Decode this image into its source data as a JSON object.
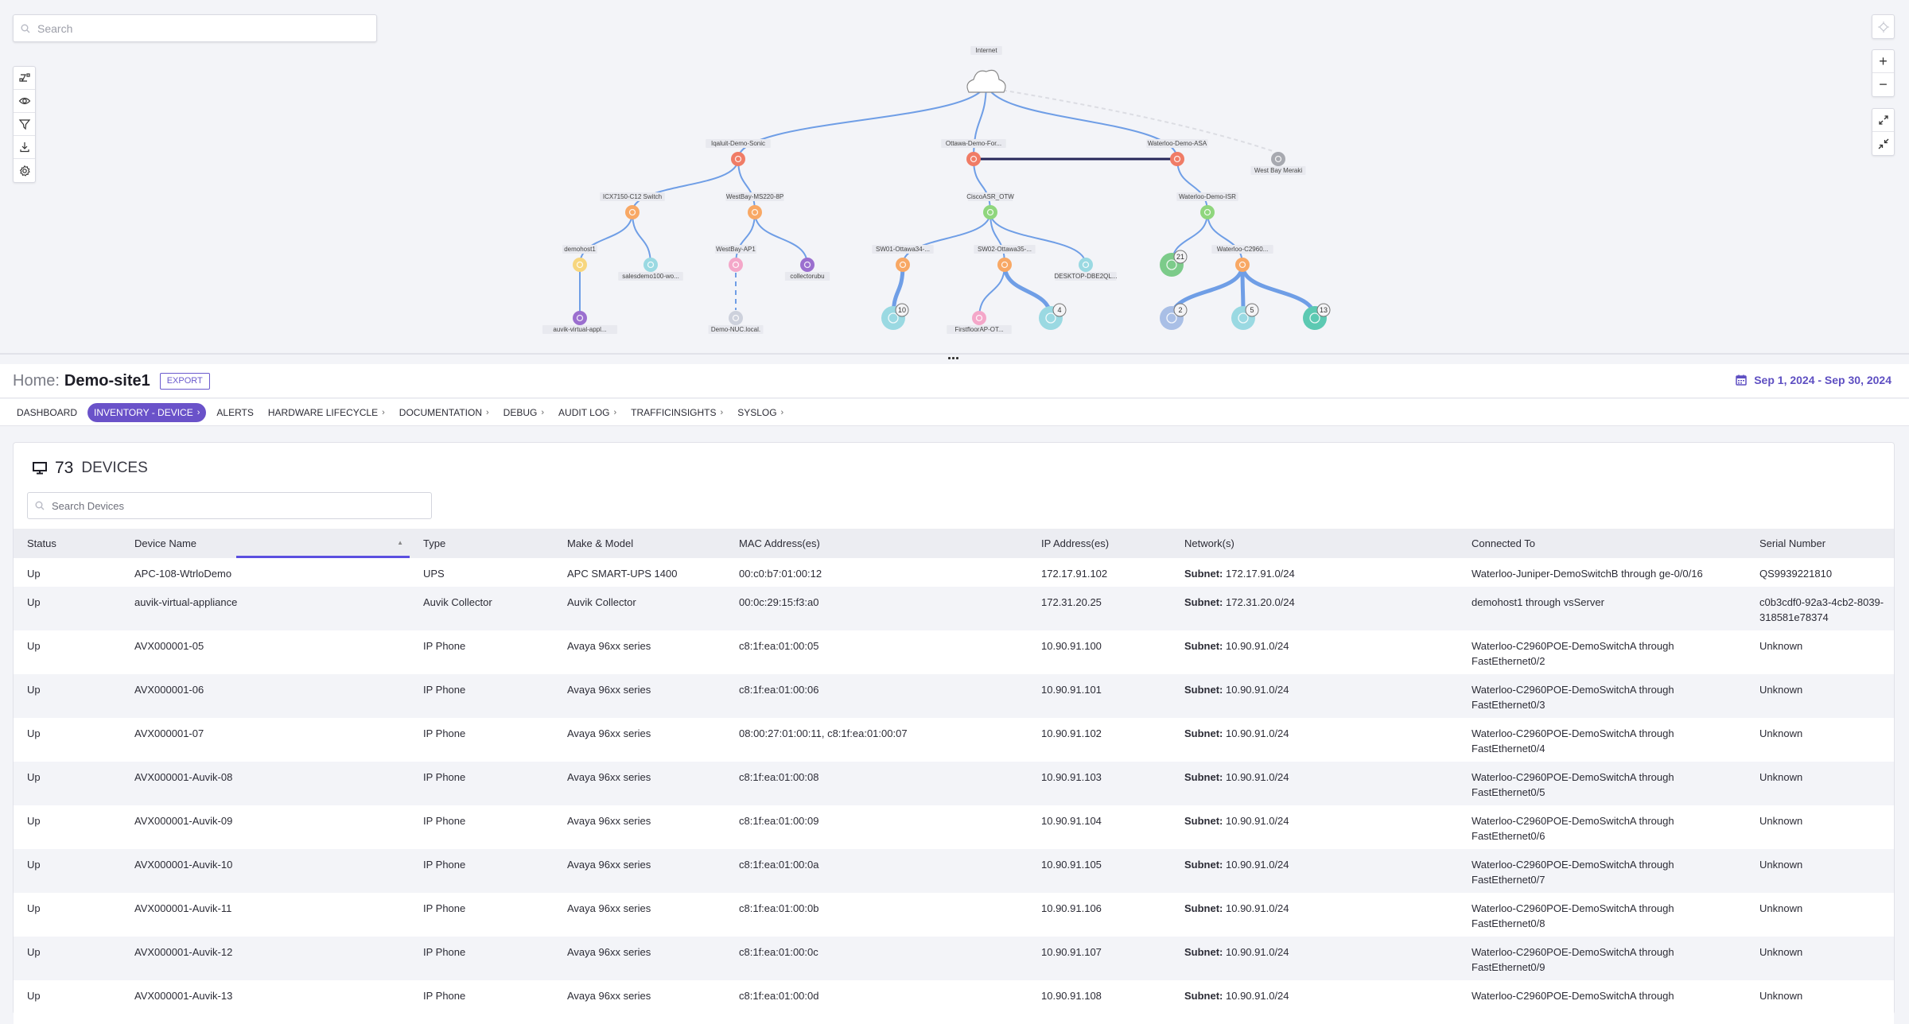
{
  "map": {
    "search_placeholder": "Search",
    "tools": [
      "layout-icon",
      "eye-icon",
      "filter-icon",
      "download-icon",
      "gear-icon"
    ],
    "right_controls": {
      "locate": "crosshair-icon",
      "zoom_in": "+",
      "zoom_out": "−",
      "expand": "expand-icon",
      "collapse": "collapse-icon"
    },
    "nodes": [
      {
        "id": "internet",
        "label": "Internet",
        "kind": "cloud",
        "color": "#ffffff"
      },
      {
        "id": "iqaluit",
        "label": "Iqaluit-Demo-Sonic",
        "kind": "firewall",
        "color": "#f07c66"
      },
      {
        "id": "ottawa",
        "label": "Ottawa-Demo-For...",
        "kind": "firewall",
        "color": "#f07c66"
      },
      {
        "id": "waterloo_asa",
        "label": "Waterloo-Demo-ASA",
        "kind": "firewall",
        "color": "#f07c66"
      },
      {
        "id": "westbay_meraki",
        "label": "West Bay Meraki",
        "kind": "cloud-gray",
        "color": "#a7a9b0"
      },
      {
        "id": "icx",
        "label": "ICX7150-C12 Switch",
        "kind": "switch",
        "color": "#f8a865"
      },
      {
        "id": "westbay_ms",
        "label": "WestBay-MS220-8P",
        "kind": "switch",
        "color": "#f8a865"
      },
      {
        "id": "ciscoasr",
        "label": "CiscoASR_OTW",
        "kind": "router",
        "color": "#8fd67d"
      },
      {
        "id": "waterloo_isr",
        "label": "Waterloo-Demo-ISR",
        "kind": "router",
        "color": "#8fd67d"
      },
      {
        "id": "demohost1",
        "label": "demohost1",
        "kind": "host",
        "color": "#f7d67e"
      },
      {
        "id": "salesdemo",
        "label": "salesdemo100-wo...",
        "kind": "workstation",
        "color": "#9ad9e2"
      },
      {
        "id": "westbay_ap1",
        "label": "WestBay-AP1",
        "kind": "ap",
        "color": "#f4a7c9"
      },
      {
        "id": "collectorubu",
        "label": "collectorubu",
        "kind": "collector",
        "color": "#9b6fcf"
      },
      {
        "id": "sw01",
        "label": "SW01-Ottawa34-...",
        "kind": "switch",
        "color": "#f8a865"
      },
      {
        "id": "sw02",
        "label": "SW02-Ottawa35-...",
        "kind": "switch",
        "color": "#f8a865"
      },
      {
        "id": "desktop",
        "label": "DESKTOP-DBE2QL...",
        "kind": "workstation",
        "color": "#9ad9e2"
      },
      {
        "id": "net_group",
        "label": "",
        "kind": "network-group",
        "color": "#7ccb8a",
        "count": "21"
      },
      {
        "id": "waterloo_c2960",
        "label": "Waterloo-C2960...",
        "kind": "switch",
        "color": "#f8a865"
      },
      {
        "id": "auvik_va",
        "label": "auvik-virtual-appl...",
        "kind": "collector",
        "color": "#9b6fcf"
      },
      {
        "id": "demo_nuc",
        "label": "Demo-NUC.local.",
        "kind": "unknown",
        "color": "#cdd1dc"
      },
      {
        "id": "ws_group10",
        "label": "",
        "kind": "workstation-group",
        "color": "#9ad9e2",
        "count": "10"
      },
      {
        "id": "firstfloor_ap",
        "label": "FirstfloorAP-OT...",
        "kind": "ap",
        "color": "#f4a7c9"
      },
      {
        "id": "ws_group4",
        "label": "",
        "kind": "workstation-group",
        "color": "#9ad9e2",
        "count": "4"
      },
      {
        "id": "printer_group",
        "label": "",
        "kind": "printer-group",
        "color": "#a9bfe6",
        "count": "2"
      },
      {
        "id": "ws_group5",
        "label": "",
        "kind": "workstation-group",
        "color": "#9ad9e2",
        "count": "5"
      },
      {
        "id": "phone_group",
        "label": "",
        "kind": "phone-group",
        "color": "#5cc9b2",
        "count": "13"
      }
    ]
  },
  "header": {
    "home_label": "Home:",
    "site_name": "Demo-site1",
    "export_label": "EXPORT",
    "date_range": "Sep 1, 2024 - Sep 30, 2024"
  },
  "tabs": [
    {
      "label": "DASHBOARD",
      "chevron": false,
      "active": false
    },
    {
      "label": "INVENTORY - DEVICE",
      "chevron": true,
      "active": true
    },
    {
      "label": "ALERTS",
      "chevron": false,
      "active": false
    },
    {
      "label": "HARDWARE LIFECYCLE",
      "chevron": true,
      "active": false
    },
    {
      "label": "DOCUMENTATION",
      "chevron": true,
      "active": false
    },
    {
      "label": "DEBUG",
      "chevron": true,
      "active": false
    },
    {
      "label": "AUDIT LOG",
      "chevron": true,
      "active": false
    },
    {
      "label": "TRAFFICINSIGHTS",
      "chevron": true,
      "active": false
    },
    {
      "label": "SYSLOG",
      "chevron": true,
      "active": false
    }
  ],
  "devices": {
    "count": "73",
    "count_label": "DEVICES",
    "search_placeholder": "Search Devices",
    "columns": [
      "Status",
      "Device Name",
      "Type",
      "Make & Model",
      "MAC Address(es)",
      "IP Address(es)",
      "Network(s)",
      "Connected To",
      "Serial Number"
    ],
    "sorted_column": "Device Name",
    "network_prefix": "Subnet:",
    "rows": [
      {
        "status": "Up",
        "name": "APC-108-WtrloDemo",
        "type": "UPS",
        "model": "APC SMART-UPS 1400",
        "mac": "00:c0:b7:01:00:12",
        "ip": "172.17.91.102",
        "network": "172.17.91.0/24",
        "connected": "Waterloo-Juniper-DemoSwitchB  through ge-0/0/16",
        "serial": "QS9939221810"
      },
      {
        "status": "Up",
        "name": "auvik-virtual-appliance",
        "type": "Auvik Collector",
        "model": "Auvik Collector",
        "mac": "00:0c:29:15:f3:a0",
        "ip": "172.31.20.25",
        "network": "172.31.20.0/24",
        "connected": "demohost1  through vsServer",
        "serial": "c0b3cdf0-92a3-4cb2-8039-318581e78374"
      },
      {
        "status": "Up",
        "name": "AVX000001-05",
        "type": "IP Phone",
        "model": "Avaya 96xx series",
        "mac": "c8:1f:ea:01:00:05",
        "ip": "10.90.91.100",
        "network": "10.90.91.0/24",
        "connected": "Waterloo-C2960POE-DemoSwitchA  through FastEthernet0/2",
        "serial": "Unknown"
      },
      {
        "status": "Up",
        "name": "AVX000001-06",
        "type": "IP Phone",
        "model": "Avaya 96xx series",
        "mac": "c8:1f:ea:01:00:06",
        "ip": "10.90.91.101",
        "network": "10.90.91.0/24",
        "connected": "Waterloo-C2960POE-DemoSwitchA  through FastEthernet0/3",
        "serial": "Unknown"
      },
      {
        "status": "Up",
        "name": "AVX000001-07",
        "type": "IP Phone",
        "model": "Avaya 96xx series",
        "mac": "08:00:27:01:00:11, c8:1f:ea:01:00:07",
        "ip": "10.90.91.102",
        "network": "10.90.91.0/24",
        "connected": "Waterloo-C2960POE-DemoSwitchA  through FastEthernet0/4",
        "serial": "Unknown"
      },
      {
        "status": "Up",
        "name": "AVX000001-Auvik-08",
        "type": "IP Phone",
        "model": "Avaya 96xx series",
        "mac": "c8:1f:ea:01:00:08",
        "ip": "10.90.91.103",
        "network": "10.90.91.0/24",
        "connected": "Waterloo-C2960POE-DemoSwitchA  through FastEthernet0/5",
        "serial": "Unknown"
      },
      {
        "status": "Up",
        "name": "AVX000001-Auvik-09",
        "type": "IP Phone",
        "model": "Avaya 96xx series",
        "mac": "c8:1f:ea:01:00:09",
        "ip": "10.90.91.104",
        "network": "10.90.91.0/24",
        "connected": "Waterloo-C2960POE-DemoSwitchA  through FastEthernet0/6",
        "serial": "Unknown"
      },
      {
        "status": "Up",
        "name": "AVX000001-Auvik-10",
        "type": "IP Phone",
        "model": "Avaya 96xx series",
        "mac": "c8:1f:ea:01:00:0a",
        "ip": "10.90.91.105",
        "network": "10.90.91.0/24",
        "connected": "Waterloo-C2960POE-DemoSwitchA  through FastEthernet0/7",
        "serial": "Unknown"
      },
      {
        "status": "Up",
        "name": "AVX000001-Auvik-11",
        "type": "IP Phone",
        "model": "Avaya 96xx series",
        "mac": "c8:1f:ea:01:00:0b",
        "ip": "10.90.91.106",
        "network": "10.90.91.0/24",
        "connected": "Waterloo-C2960POE-DemoSwitchA  through FastEthernet0/8",
        "serial": "Unknown"
      },
      {
        "status": "Up",
        "name": "AVX000001-Auvik-12",
        "type": "IP Phone",
        "model": "Avaya 96xx series",
        "mac": "c8:1f:ea:01:00:0c",
        "ip": "10.90.91.107",
        "network": "10.90.91.0/24",
        "connected": "Waterloo-C2960POE-DemoSwitchA  through FastEthernet0/9",
        "serial": "Unknown"
      },
      {
        "status": "Up",
        "name": "AVX000001-Auvik-13",
        "type": "IP Phone",
        "model": "Avaya 96xx series",
        "mac": "c8:1f:ea:01:00:0d",
        "ip": "10.90.91.108",
        "network": "10.90.91.0/24",
        "connected": "Waterloo-C2960POE-DemoSwitchA  through",
        "serial": "Unknown"
      }
    ]
  },
  "colors": {
    "accent": "#6a52c9",
    "link_line": "#6f9ee6",
    "firewall": "#f07c66",
    "switch": "#f8a865",
    "router": "#8fd67d"
  }
}
